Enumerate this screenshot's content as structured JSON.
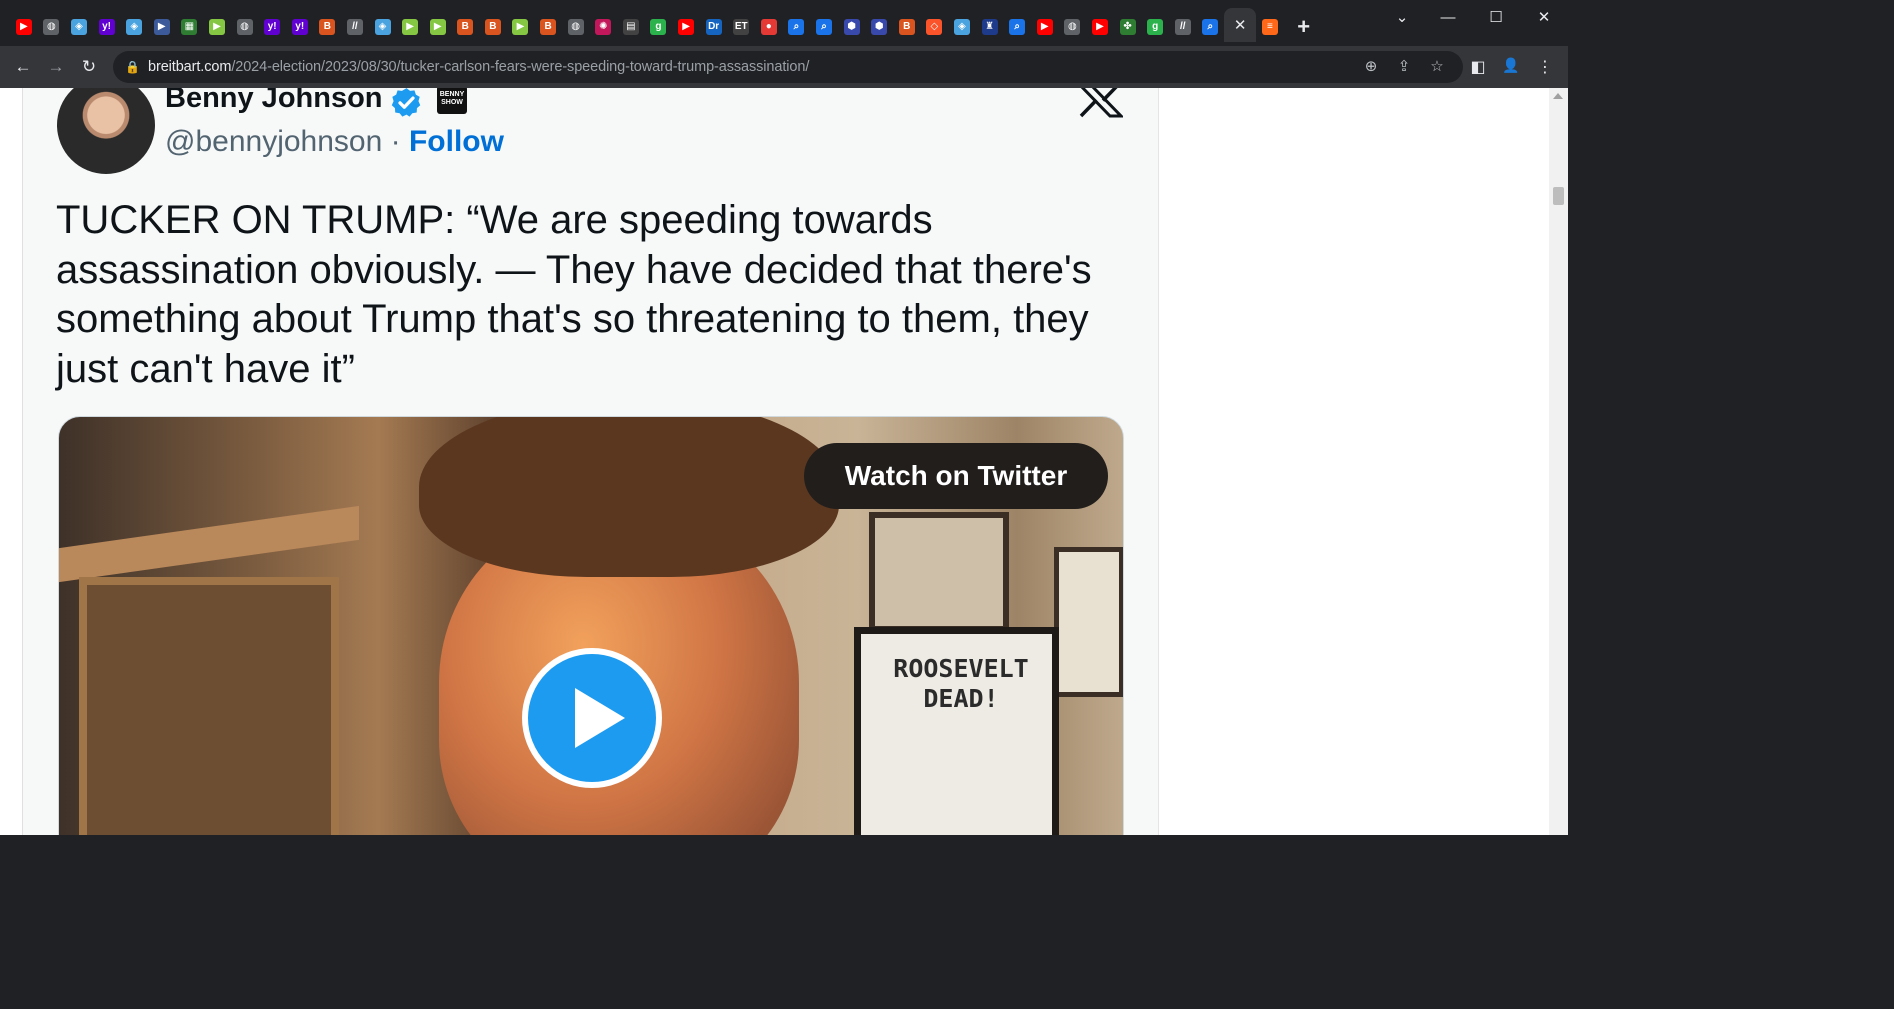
{
  "browser": {
    "tab_favicons": [
      {
        "icon": "youtube-icon",
        "color": "#ff0000",
        "glyph": "▶"
      },
      {
        "icon": "globe-icon",
        "color": "#5f6368",
        "glyph": "◍"
      },
      {
        "icon": "shield-icon",
        "color": "#4aa3df",
        "glyph": "◈"
      },
      {
        "icon": "yahoo-icon",
        "color": "#6001d2",
        "glyph": "y!"
      },
      {
        "icon": "shield-icon",
        "color": "#4aa3df",
        "glyph": "◈"
      },
      {
        "icon": "flag-icon",
        "color": "#3c5a99",
        "glyph": "▶"
      },
      {
        "icon": "grid-icon",
        "color": "#2e7d32",
        "glyph": "▦"
      },
      {
        "icon": "rumble-icon",
        "color": "#85c742",
        "glyph": "▶"
      },
      {
        "icon": "globe-icon",
        "color": "#5f6368",
        "glyph": "◍"
      },
      {
        "icon": "yahoo-icon",
        "color": "#6001d2",
        "glyph": "y!"
      },
      {
        "icon": "yahoo-icon",
        "color": "#6001d2",
        "glyph": "y!"
      },
      {
        "icon": "breitbart-icon",
        "color": "#d9541e",
        "glyph": "B"
      },
      {
        "icon": "slash-icon",
        "color": "#5f6368",
        "glyph": "//"
      },
      {
        "icon": "shield-icon",
        "color": "#4aa3df",
        "glyph": "◈"
      },
      {
        "icon": "rumble-icon",
        "color": "#85c742",
        "glyph": "▶"
      },
      {
        "icon": "rumble-icon",
        "color": "#85c742",
        "glyph": "▶"
      },
      {
        "icon": "breitbart-icon",
        "color": "#d9541e",
        "glyph": "B"
      },
      {
        "icon": "breitbart-icon",
        "color": "#d9541e",
        "glyph": "B"
      },
      {
        "icon": "rumble-icon",
        "color": "#85c742",
        "glyph": "▶"
      },
      {
        "icon": "breitbart-icon",
        "color": "#d9541e",
        "glyph": "B"
      },
      {
        "icon": "globe-icon",
        "color": "#5f6368",
        "glyph": "◍"
      },
      {
        "icon": "burst-icon",
        "color": "#c2185b",
        "glyph": "✺"
      },
      {
        "icon": "news-icon",
        "color": "#424242",
        "glyph": "▤"
      },
      {
        "icon": "gettr-icon",
        "color": "#2bb24c",
        "glyph": "g"
      },
      {
        "icon": "youtube-icon",
        "color": "#ff0000",
        "glyph": "▶"
      },
      {
        "icon": "drudge-icon",
        "color": "#1565c0",
        "glyph": "Dr"
      },
      {
        "icon": "epochtimes-icon",
        "color": "#424242",
        "glyph": "ET"
      },
      {
        "icon": "mic-icon",
        "color": "#e53935",
        "glyph": "●"
      },
      {
        "icon": "search-icon",
        "color": "#1a73e8",
        "glyph": "⌕"
      },
      {
        "icon": "search-icon",
        "color": "#1a73e8",
        "glyph": "⌕"
      },
      {
        "icon": "cube-icon",
        "color": "#3949ab",
        "glyph": "⬢"
      },
      {
        "icon": "cube-icon",
        "color": "#3949ab",
        "glyph": "⬢"
      },
      {
        "icon": "breitbart-icon",
        "color": "#d9541e",
        "glyph": "B"
      },
      {
        "icon": "brave-icon",
        "color": "#fb542b",
        "glyph": "◇"
      },
      {
        "icon": "shield-icon",
        "color": "#4aa3df",
        "glyph": "◈"
      },
      {
        "icon": "crest-icon",
        "color": "#1e3a8a",
        "glyph": "♜"
      },
      {
        "icon": "search-icon",
        "color": "#1a73e8",
        "glyph": "⌕"
      },
      {
        "icon": "youtube-icon",
        "color": "#ff0000",
        "glyph": "▶"
      },
      {
        "icon": "globe-icon",
        "color": "#5f6368",
        "glyph": "◍"
      },
      {
        "icon": "youtube-icon",
        "color": "#ff0000",
        "glyph": "▶"
      },
      {
        "icon": "leaf-icon",
        "color": "#2e7d32",
        "glyph": "✤"
      },
      {
        "icon": "gettr-icon",
        "color": "#2bb24c",
        "glyph": "g"
      },
      {
        "icon": "slash-icon",
        "color": "#5f6368",
        "glyph": "//"
      },
      {
        "icon": "search-icon",
        "color": "#1a73e8",
        "glyph": "⌕"
      }
    ],
    "active_tab_close": "✕",
    "after_tab_icon": {
      "icon": "substack-icon",
      "color": "#ff6719",
      "glyph": "≡"
    },
    "new_tab": "+",
    "window_controls": {
      "tab_search": "⌄",
      "minimize": "—",
      "maximize": "☐",
      "close": "✕"
    },
    "nav": {
      "back": "←",
      "forward": "→",
      "reload": "↻"
    },
    "url_host": "breitbart.com",
    "url_path": "/2024-election/2023/08/30/tucker-carlson-fears-were-speeding-toward-trump-assassination/",
    "lock": "🔒",
    "omnibox_icons": {
      "zoom": "⊕",
      "share": "⇪",
      "bookmark": "☆"
    },
    "toolbar_icons": {
      "side_panel": "◧",
      "profile": "👤",
      "menu": "⋮"
    }
  },
  "tweet": {
    "author_name": "Benny Johnson",
    "badge_text": "BENNY SHOW",
    "handle": "@bennyjohnson",
    "separator": " · ",
    "follow_label": "Follow",
    "text": "TUCKER ON TRUMP:  “We are speeding towards assassination obviously. — They have decided that there's something about Trump that's so threatening to them, they just can't have it”",
    "watch_label": "Watch on Twitter",
    "poster_text": "ROOSEVELT DEAD!"
  },
  "colors": {
    "follow_blue": "#006fd6",
    "play_blue": "#1d9bf0",
    "verified_blue": "#1d9bf0"
  }
}
